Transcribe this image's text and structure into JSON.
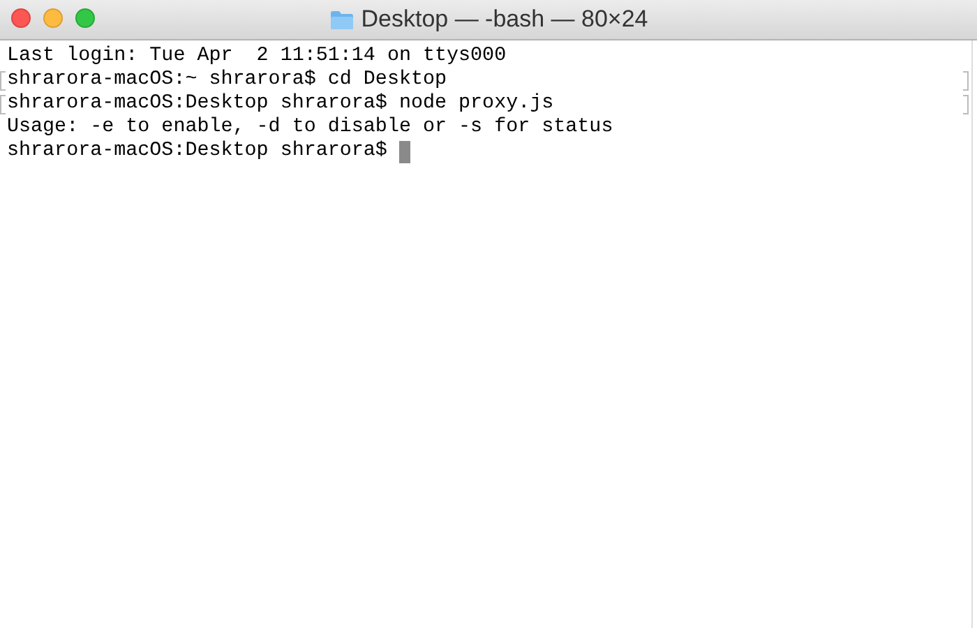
{
  "window": {
    "title": "Desktop — -bash — 80×24"
  },
  "lines": [
    {
      "text": "Last login: Tue Apr  2 11:51:14 on ttys000",
      "marked": false
    },
    {
      "text": "shrarora-macOS:~ shrarora$ cd Desktop",
      "marked": true
    },
    {
      "text": "shrarora-macOS:Desktop shrarora$ node proxy.js",
      "marked": true
    },
    {
      "text": "Usage: -e to enable, -d to disable or -s for status",
      "marked": false
    },
    {
      "text": "shrarora-macOS:Desktop shrarora$ ",
      "marked": false,
      "cursor": true
    }
  ]
}
